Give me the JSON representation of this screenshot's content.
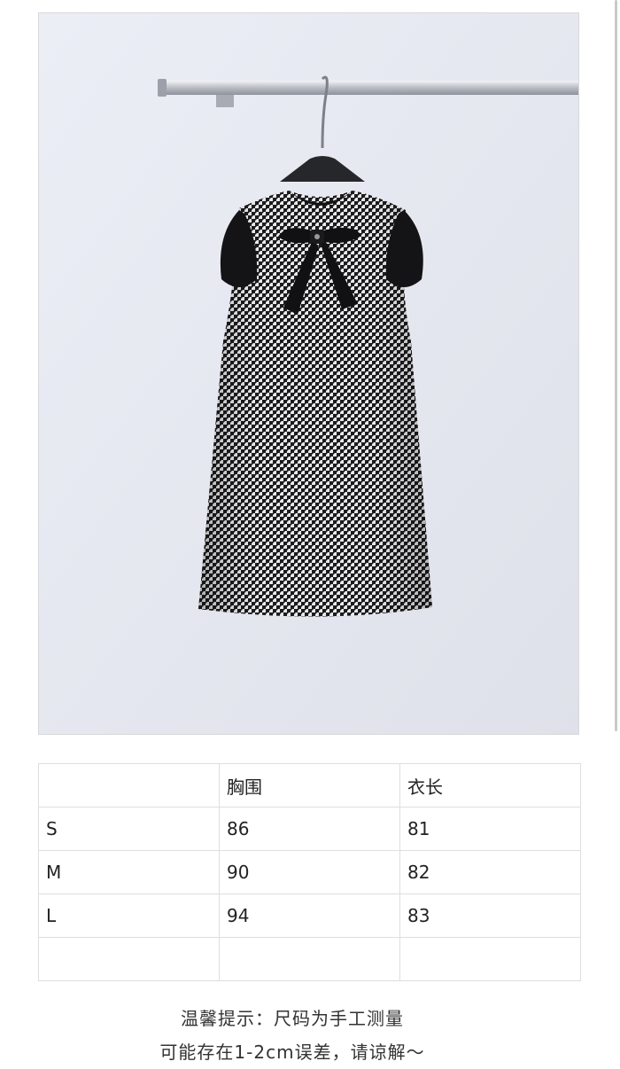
{
  "product_photo": {
    "alt": "houndstooth sleeveless dress with black bow on hanger"
  },
  "size_table": {
    "headers": [
      "",
      "胸围",
      "衣长"
    ],
    "rows": [
      [
        "S",
        "86",
        "81"
      ],
      [
        "M",
        "90",
        "82"
      ],
      [
        "L",
        "94",
        "83"
      ],
      [
        "",
        "",
        ""
      ]
    ]
  },
  "note": {
    "line1": "温馨提示：尺码为手工测量",
    "line2": "可能存在1-2cm误差，请谅解～"
  }
}
